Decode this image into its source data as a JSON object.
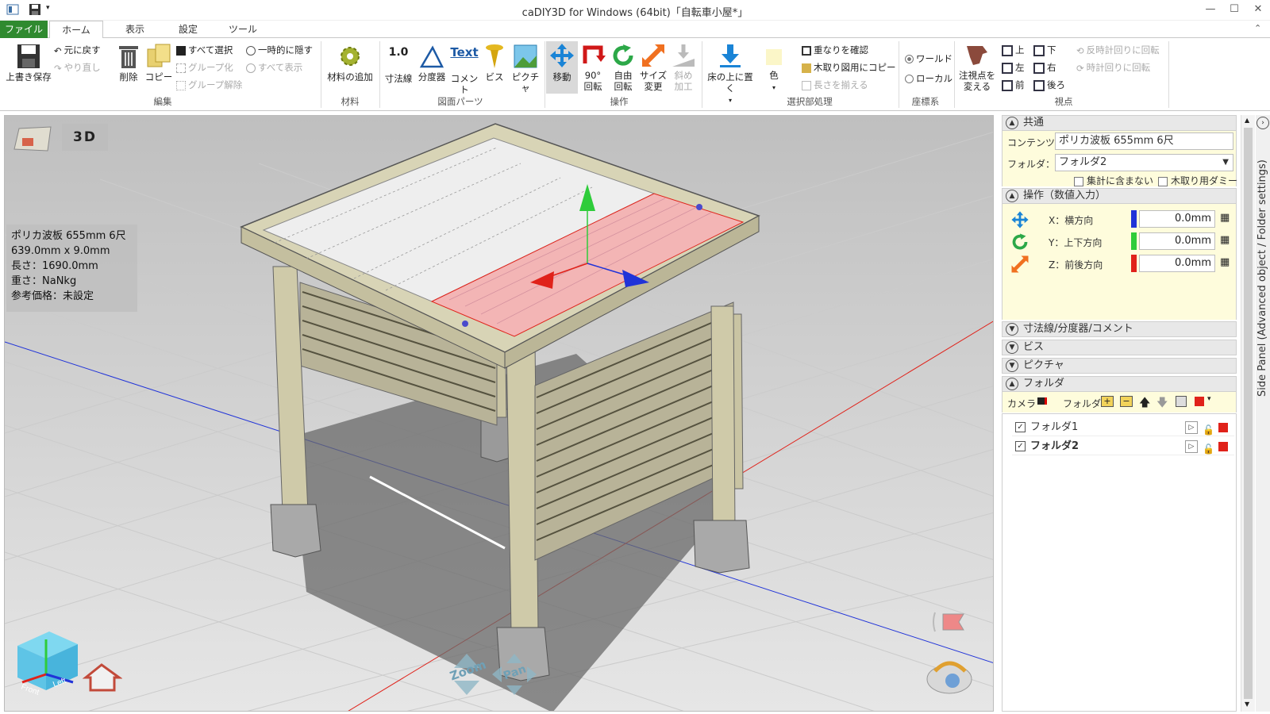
{
  "window": {
    "title": "caDIY3D for Windows (64bit)「自転車小屋*」",
    "minimize": "—",
    "maximize": "☐",
    "close": "✕",
    "help": "?"
  },
  "tabs": [
    {
      "label": "ファイル"
    },
    {
      "label": "ホーム"
    },
    {
      "label": "表示"
    },
    {
      "label": "設定"
    },
    {
      "label": "ツール"
    }
  ],
  "ribbon": {
    "save": "上書き保存",
    "undo": "元に戻す",
    "redo": "やり直し",
    "delete": "削除",
    "copy": "コピー",
    "select_all": "すべて選択",
    "group": "グループ化",
    "ungroup": "グループ解除",
    "hide_temp": "一時的に隠す",
    "show_all": "すべて表示",
    "add_material": "材料の追加",
    "dimension_icon": "1.0",
    "dimension": "寸法線",
    "protractor": "分度器",
    "comment_icon": "Text",
    "comment": "コメント",
    "screw": "ビス",
    "picture": "ピクチャ",
    "move": "移動",
    "rotate90_l1": "90°",
    "rotate90_l2": "回転",
    "free_l1": "自由",
    "free_l2": "回転",
    "size_l1": "サイズ",
    "size_l2": "変更",
    "slant_l1": "斜め",
    "slant_l2": "加工",
    "place_floor": "床の上に置く",
    "color": "色",
    "check_overlap": "重なりを確認",
    "copy_cut": "木取り図用にコピー",
    "align_length": "長さを揃える",
    "world": "ワールド",
    "local": "ローカル",
    "change_view_l1": "注視点を",
    "change_view_l2": "変える",
    "view_top": "上",
    "view_bottom": "下",
    "view_left": "左",
    "view_right": "右",
    "view_front": "前",
    "view_back": "後ろ",
    "rot_ccw": "反時計回りに回転",
    "rot_cw": "時計回りに回転",
    "groups": {
      "edit": "編集",
      "material": "材料",
      "parts": "図面パーツ",
      "operation": "操作",
      "selection": "選択部処理",
      "coord": "座標系",
      "view": "視点"
    }
  },
  "viewport": {
    "label": "3D",
    "zoom": "Zoom",
    "pan": "Pan",
    "front": "Front",
    "left": "Left",
    "info": {
      "name": "ポリカ波板 655mm 6尺",
      "dims": "639.0mm x 9.0mm",
      "length": "長さ：1690.0mm",
      "weight": "重さ：NaNkg",
      "price": "参考価格：未設定"
    }
  },
  "sidepanel": {
    "common": {
      "title": "共通",
      "content_label": "コンテンツ：",
      "content_value": "ポリカ波板 655mm 6尺",
      "folder_label": "フォルダ：",
      "folder_value": "フォルダ2",
      "exclude_total": "集計に含まない",
      "dummy_cut": "木取り用ダミー"
    },
    "operation": {
      "title": "操作（数値入力）",
      "x_label": "X：横方向",
      "y_label": "Y：上下方向",
      "z_label": "Z：前後方向",
      "x": "0.0mm",
      "y": "0.0mm",
      "z": "0.0mm"
    },
    "collapsed": [
      "寸法線/分度器/コメント",
      "ビス",
      "ピクチャ"
    ],
    "folder": {
      "title": "フォルダ",
      "camera": "カメラ",
      "folder": "フォルダ",
      "items": [
        {
          "name": "フォルダ1"
        },
        {
          "name": "フォルダ2"
        }
      ]
    },
    "sidetab": "Side Panel (Advanced object / Folder settings)"
  },
  "colors": {
    "file_tab": "#2f8a2f",
    "axis_x": "#2033d8",
    "axis_y": "#2ecc3a",
    "axis_z": "#e0221a",
    "panel_yellow": "#fefcdc"
  }
}
